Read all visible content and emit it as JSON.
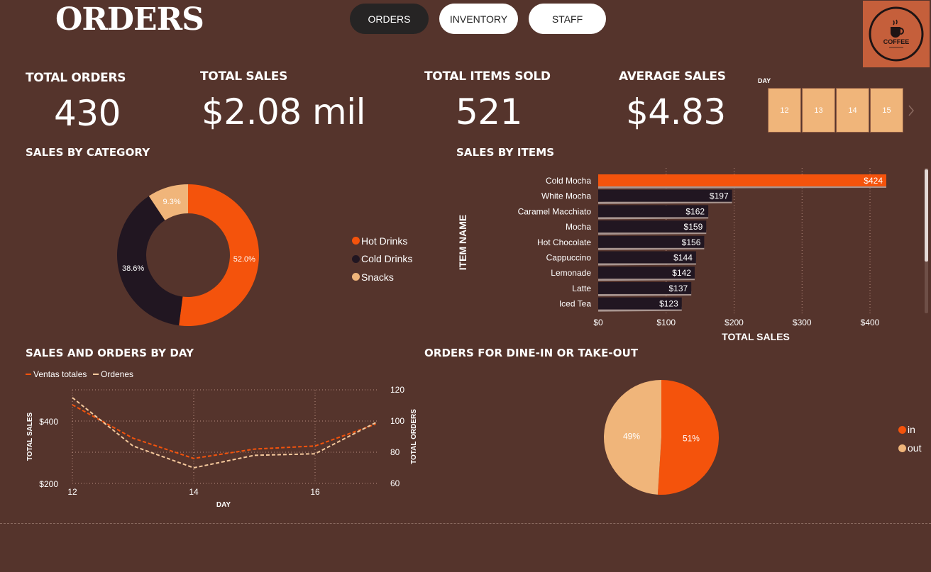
{
  "header": {
    "title": "ORDERS",
    "nav": [
      "ORDERS",
      "INVENTORY",
      "STAFF"
    ],
    "logo": {
      "text": "COFFEE",
      "icon": "coffee-cup-icon"
    }
  },
  "kpis": [
    {
      "label": "TOTAL ORDERS",
      "value": "430"
    },
    {
      "label": "TOTAL SALES",
      "value": "$2.08 mil"
    },
    {
      "label": "TOTAL ITEMS SOLD",
      "value": "521"
    },
    {
      "label": "AVERAGE SALES",
      "value": "$4.83"
    }
  ],
  "day_slicer": {
    "label": "DAY",
    "days": [
      "12",
      "13",
      "14",
      "15"
    ],
    "next_icon": "chevron-right-icon"
  },
  "colors": {
    "background": "#55342c",
    "orange": "#f4530c",
    "dark": "#211621",
    "peach": "#f0b57a",
    "cream": "#f5c99d"
  },
  "chart_data": [
    {
      "title": "SALES BY CATEGORY",
      "type": "donut",
      "series": [
        {
          "name": "Hot Drinks",
          "value": 52.0,
          "label": "52.0%"
        },
        {
          "name": "Cold Drinks",
          "value": 38.6,
          "label": "38.6%"
        },
        {
          "name": "Snacks",
          "value": 9.3,
          "label": "9.3%"
        }
      ],
      "legend": [
        "Hot Drinks",
        "Cold Drinks",
        "Snacks"
      ]
    },
    {
      "title": "SALES BY ITEMS",
      "type": "bar",
      "orientation": "horizontal",
      "categories": [
        "Cold Mocha",
        "White Mocha",
        "Caramel Macchiato",
        "Mocha",
        "Hot Chocolate",
        "Cappuccino",
        "Lemonade",
        "Latte",
        "Iced Tea"
      ],
      "values": [
        424,
        197,
        162,
        159,
        156,
        144,
        142,
        137,
        123
      ],
      "value_labels": [
        "$424",
        "$197",
        "$162",
        "$159",
        "$156",
        "$144",
        "$142",
        "$137",
        "$123"
      ],
      "xlabel": "TOTAL SALES",
      "ylabel": "ITEM NAME",
      "xticks": [
        "$0",
        "$100",
        "$200",
        "$300",
        "$400"
      ],
      "xlim": [
        0,
        424
      ]
    },
    {
      "title": "SALES AND ORDERS BY DAY",
      "type": "line",
      "x": [
        12,
        13,
        14,
        15,
        16,
        17
      ],
      "series": [
        {
          "name": "Ventas totales",
          "values": [
            452,
            345,
            280,
            310,
            320,
            390
          ],
          "axis": "left"
        },
        {
          "name": "Ordenes",
          "values": [
            115,
            84,
            70,
            78,
            79,
            99
          ],
          "axis": "right"
        }
      ],
      "xlabel": "DAY",
      "ylabel_left": "TOTAL SALES",
      "ylabel_right": "TOTAL ORDERS",
      "xticks": [
        "12",
        "14",
        "16"
      ],
      "yticks_left": [
        "$400",
        "$200"
      ],
      "yticks_right": [
        "120",
        "100",
        "80",
        "60"
      ],
      "ylim_left": [
        200,
        500
      ],
      "ylim_right": [
        60,
        120
      ]
    },
    {
      "title": "ORDERS FOR DINE-IN OR TAKE-OUT",
      "type": "pie",
      "series": [
        {
          "name": "in",
          "value": 51,
          "label": "51%"
        },
        {
          "name": "out",
          "value": 49,
          "label": "49%"
        }
      ],
      "legend": [
        "in",
        "out"
      ]
    }
  ]
}
